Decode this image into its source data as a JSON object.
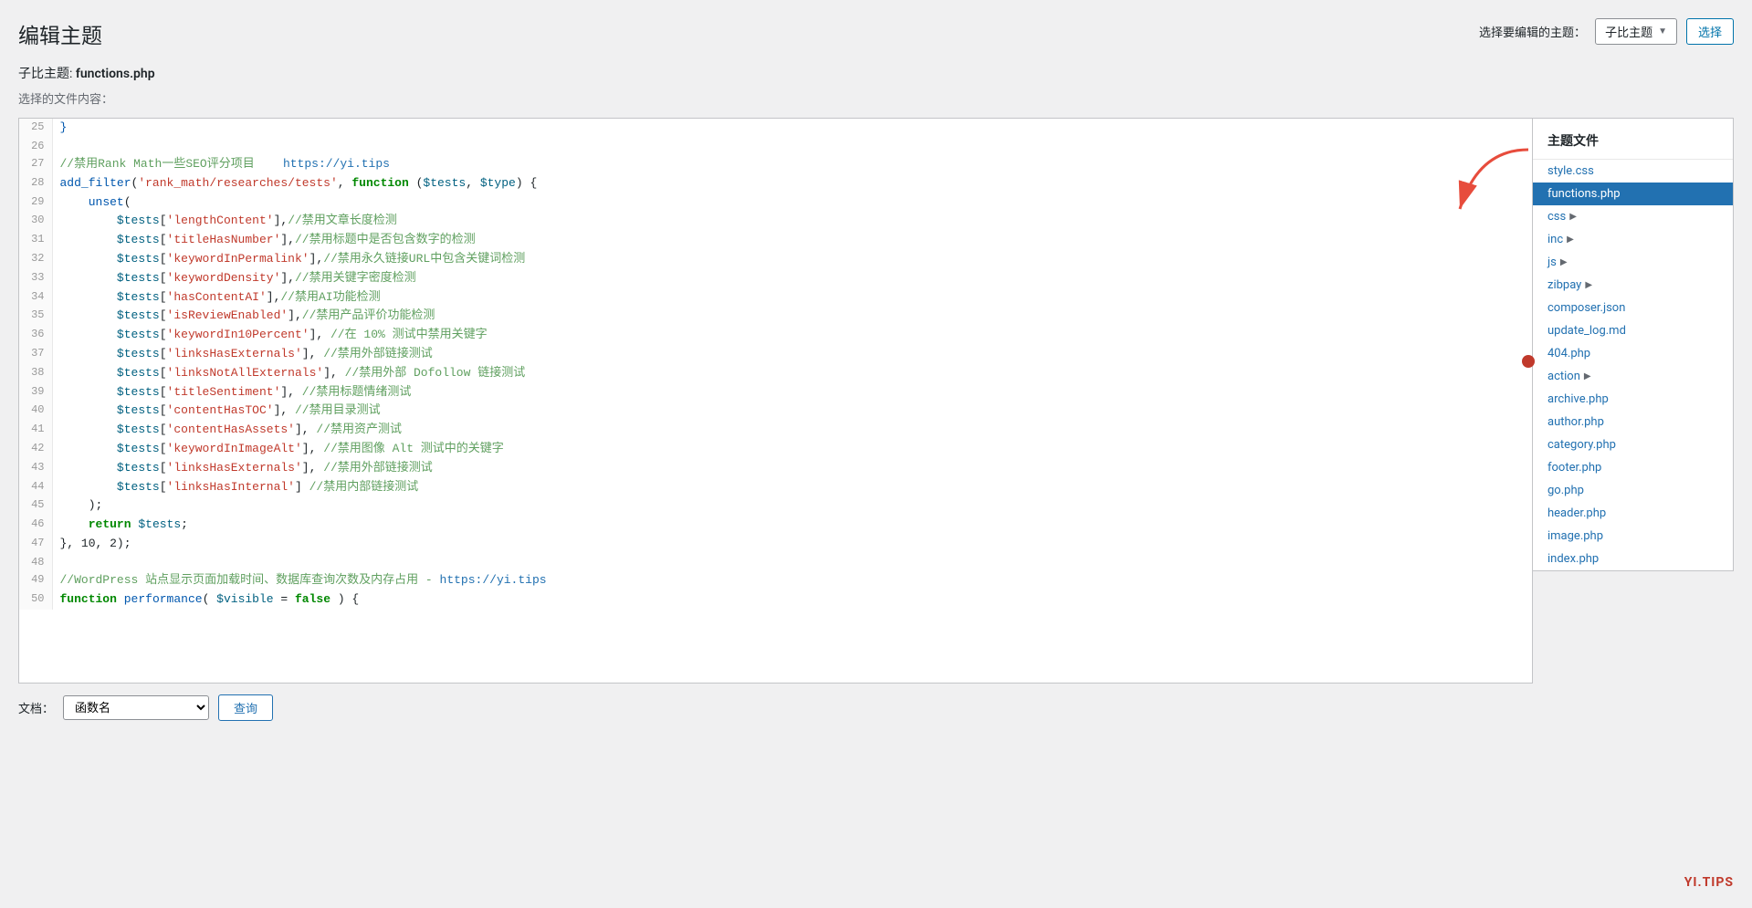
{
  "page": {
    "title": "编辑主题",
    "subtitle_label": "子比主题:",
    "subtitle_file": "functions.php",
    "file_content_label": "选择的文件内容：",
    "theme_selector_label": "选择要编辑的主题：",
    "theme_dropdown_value": "子比主题",
    "select_button_label": "选择",
    "theme_files_title": "主题文件"
  },
  "bottom_bar": {
    "label": "文档：",
    "select_placeholder": "函数名",
    "button_label": "查询"
  },
  "brand": "YI.TIPS",
  "files": [
    {
      "name": "style.css",
      "type": "file",
      "active": false
    },
    {
      "name": "functions.php",
      "type": "file",
      "active": true
    },
    {
      "name": "css",
      "type": "folder",
      "active": false
    },
    {
      "name": "inc",
      "type": "folder",
      "active": false
    },
    {
      "name": "js",
      "type": "folder",
      "active": false
    },
    {
      "name": "zibpay",
      "type": "folder",
      "active": false
    },
    {
      "name": "composer.json",
      "type": "file",
      "active": false
    },
    {
      "name": "update_log.md",
      "type": "file",
      "active": false
    },
    {
      "name": "404.php",
      "type": "file",
      "active": false
    },
    {
      "name": "action",
      "type": "folder",
      "active": false
    },
    {
      "name": "archive.php",
      "type": "file",
      "active": false
    },
    {
      "name": "author.php",
      "type": "file",
      "active": false
    },
    {
      "name": "category.php",
      "type": "file",
      "active": false
    },
    {
      "name": "footer.php",
      "type": "file",
      "active": false
    },
    {
      "name": "go.php",
      "type": "file",
      "active": false
    },
    {
      "name": "header.php",
      "type": "file",
      "active": false
    },
    {
      "name": "image.php",
      "type": "file",
      "active": false
    },
    {
      "name": "index.php",
      "type": "file",
      "active": false
    }
  ],
  "code_lines": [
    {
      "num": 25,
      "content": "}"
    },
    {
      "num": 26,
      "content": ""
    },
    {
      "num": 27,
      "content": "//禁用Rank Math一些SEO评分项目    https://yi.tips",
      "type": "comment_url"
    },
    {
      "num": 28,
      "content": "add_filter('rank_math/researches/tests', function ($tests, $type) {",
      "type": "code"
    },
    {
      "num": 29,
      "content": "    unset(",
      "type": "code"
    },
    {
      "num": 30,
      "content": "        $tests['lengthContent'],//禁用文章长度检测",
      "type": "code_comment"
    },
    {
      "num": 31,
      "content": "        $tests['titleHasNumber'],//禁用标题中是否包含数字的检测",
      "type": "code_comment"
    },
    {
      "num": 32,
      "content": "        $tests['keywordInPermalink'],//禁用永久链接URL中包含关键词检测",
      "type": "code_comment"
    },
    {
      "num": 33,
      "content": "        $tests['keywordDensity'],//禁用关键字密度检测",
      "type": "code_comment"
    },
    {
      "num": 34,
      "content": "        $tests['hasContentAI'],//禁用AI功能检测",
      "type": "code_comment"
    },
    {
      "num": 35,
      "content": "        $tests['isReviewEnabled'],//禁用产品评价功能检测",
      "type": "code_comment"
    },
    {
      "num": 36,
      "content": "        $tests['keywordIn10Percent'], //在 10% 测试中禁用关键字",
      "type": "code_comment"
    },
    {
      "num": 37,
      "content": "        $tests['linksHasExternals'], //禁用外部链接测试",
      "type": "code_comment"
    },
    {
      "num": 38,
      "content": "        $tests['linksNotAllExternals'], //禁用外部 Dofollow 链接测试",
      "type": "code_comment"
    },
    {
      "num": 39,
      "content": "        $tests['titleSentiment'], //禁用标题情绪测试",
      "type": "code_comment"
    },
    {
      "num": 40,
      "content": "        $tests['contentHasTOC'], //禁用目录测试",
      "type": "code_comment"
    },
    {
      "num": 41,
      "content": "        $tests['contentHasAssets'], //禁用资产测试",
      "type": "code_comment"
    },
    {
      "num": 42,
      "content": "        $tests['keywordInImageAlt'], //禁用图像 Alt 测试中的关键字",
      "type": "code_comment"
    },
    {
      "num": 43,
      "content": "        $tests['linksHasExternals'], //禁用外部链接测试",
      "type": "code_comment"
    },
    {
      "num": 44,
      "content": "        $tests['linksHasInternal'] //禁用内部链接测试",
      "type": "code_comment"
    },
    {
      "num": 45,
      "content": "    );",
      "type": "code"
    },
    {
      "num": 46,
      "content": "    return $tests;",
      "type": "code"
    },
    {
      "num": 47,
      "content": "}, 10, 2);",
      "type": "code"
    },
    {
      "num": 48,
      "content": ""
    },
    {
      "num": 49,
      "content": "//WordPress 站点显示页面加载时间、数据库查询次数及内存占用 - https://yi.tips",
      "type": "comment_url2"
    },
    {
      "num": 50,
      "content": "function performance( $visible = false ) {",
      "type": "code"
    }
  ]
}
